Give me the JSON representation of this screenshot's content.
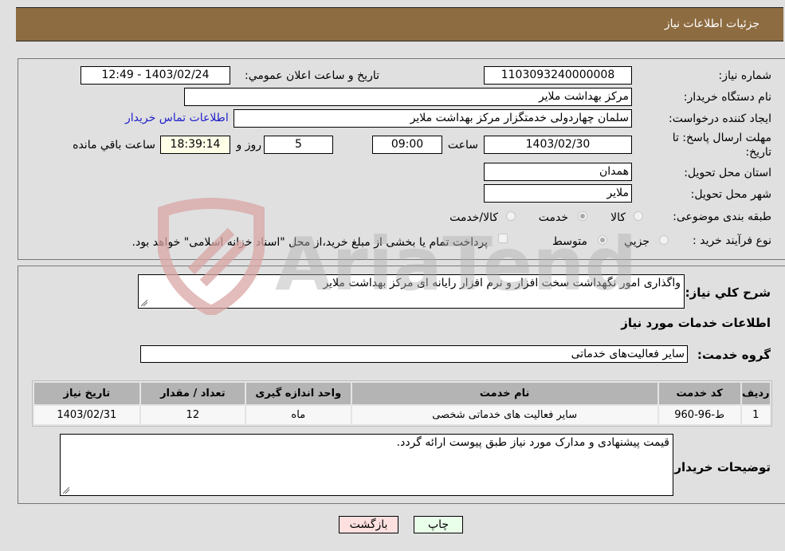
{
  "header": {
    "title": "جزئیات اطلاعات نیاز"
  },
  "form": {
    "need_number": {
      "label": "شماره نیاز:",
      "value": "1103093240000008"
    },
    "announce_datetime": {
      "label": "تاریخ و ساعت اعلان عمومي:",
      "value": "1403/02/24 - 12:49"
    },
    "buyer_org": {
      "label": "نام دستگاه خريدار:",
      "value": "مرکز بهداشت ملاير"
    },
    "requester": {
      "label": "ايجاد کننده درخواست:",
      "value": "سلمان چهاردولی خدمتگزار مرکز بهداشت ملاير"
    },
    "buyer_contact_link": "اطلاعات تماس خريدار",
    "deadline": {
      "label_line1": "مهلت ارسال پاسخ: تا",
      "label_line2": "تاريخ:",
      "date": "1403/02/30",
      "time_label": "ساعت",
      "time": "09:00",
      "days": "5",
      "days_label": "روز و",
      "remaining": "18:39:14",
      "remaining_label": "ساعت باقي مانده"
    },
    "province": {
      "label": "استان محل تحویل:",
      "value": "همدان"
    },
    "city": {
      "label": "شهر محل تحویل:",
      "value": "ملاير"
    },
    "category": {
      "label": "طبقه بندی موضوعی:",
      "options": [
        "کالا",
        "خدمت",
        "کالا/خدمت"
      ],
      "selected": "خدمت"
    },
    "purchase_type": {
      "label": "نوع فرآيند خريد :",
      "options": [
        "جزيي",
        "متوسط"
      ],
      "selected": "متوسط",
      "treasury_note": "پرداخت تمام يا بخشی از مبلغ خريد،از محل \"اسناد خزانه اسلامی\" خواهد بود."
    }
  },
  "details": {
    "description_label": "شرح كلي نياز:",
    "description": "واگذاری امور نگهداشت سخت افزار و نرم افزار رایانه ای مرکز بهداشت ملاير",
    "services_heading": "اطلاعات خدمات مورد نياز",
    "service_group_label": "گروه خدمت:",
    "service_group": "ساير فعاليت‌هاى خدماتى",
    "table": {
      "headers": [
        "رديف",
        "کد خدمت",
        "نام خدمت",
        "واحد اندازه گيری",
        "تعداد / مقدار",
        "تاريخ نياز"
      ],
      "rows": [
        [
          "1",
          "ط-96-960",
          "ساير فعاليت های خدماتی شخصی",
          "ماه",
          "12",
          "1403/02/31"
        ]
      ]
    },
    "buyer_notes_label": "توضيحات خريدار:",
    "buyer_notes": "قيمت پيشنهادی و مدارک مورد نياز طبق پيوست ارائه گردد."
  },
  "buttons": {
    "print": "چاپ",
    "back": "بازگشت"
  },
  "watermark": "AriaTender.neT",
  "colors": {
    "header_bg": "#8e6c41",
    "print_bg": "#eaffea",
    "back_bg": "#ffe0e0",
    "link": "#1f1fcc"
  }
}
